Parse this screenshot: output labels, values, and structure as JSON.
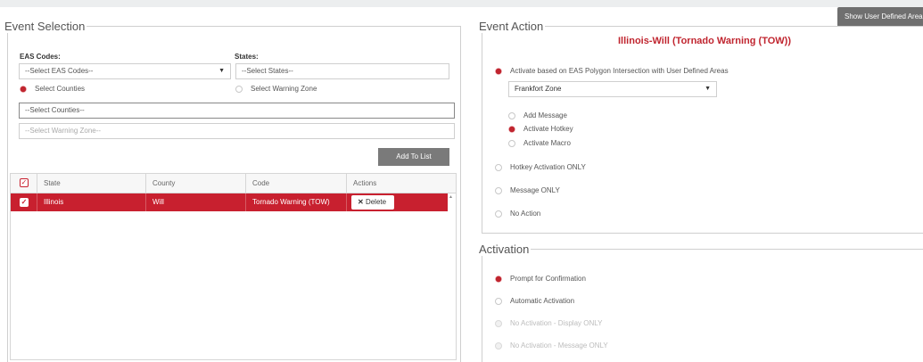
{
  "header": {
    "show_user_defined_areas": "Show User Defined Areas"
  },
  "event_selection": {
    "legend": "Event Selection",
    "eas_codes_label": "EAS Codes:",
    "eas_codes_value": "--Select EAS Codes--",
    "states_label": "States:",
    "states_value": "--Select States--",
    "radio_select_counties": "Select Counties",
    "radio_select_warning_zone": "Select Warning Zone",
    "counties_value": "--Select Counties--",
    "warning_zone_value": "--Select Warning Zone--",
    "add_to_list": "Add To List",
    "table": {
      "columns": [
        "State",
        "County",
        "Code",
        "Actions"
      ],
      "rows": [
        {
          "state": "Illinois",
          "county": "Will",
          "code": "Tornado Warning (TOW)",
          "action": "Delete"
        }
      ]
    }
  },
  "event_action": {
    "legend": "Event Action",
    "title": "Illinois-Will (Tornado Warning (TOW))",
    "opt_polygon": "Activate based on EAS Polygon Intersection with User Defined Areas",
    "zone_value": "Frankfort Zone",
    "sub_add_message": "Add Message",
    "sub_activate_hotkey": "Activate Hotkey",
    "sub_activate_macro": "Activate Macro",
    "opt_hotkey_only": "Hotkey Activation ONLY",
    "opt_message_only": "Message ONLY",
    "opt_no_action": "No Action"
  },
  "activation": {
    "legend": "Activation",
    "opt_prompt": "Prompt for Confirmation",
    "opt_automatic": "Automatic Activation",
    "opt_display_only": "No Activation - Display ONLY",
    "opt_message_only": "No Activation - Message ONLY"
  },
  "colors": {
    "accent": "#c8202f",
    "title_red": "#c0252f",
    "button_gray": "#7a7a7a"
  },
  "icons": {
    "dropdown": "chevron-down-icon",
    "delete": "close-icon",
    "check": "checkbox-icon"
  }
}
